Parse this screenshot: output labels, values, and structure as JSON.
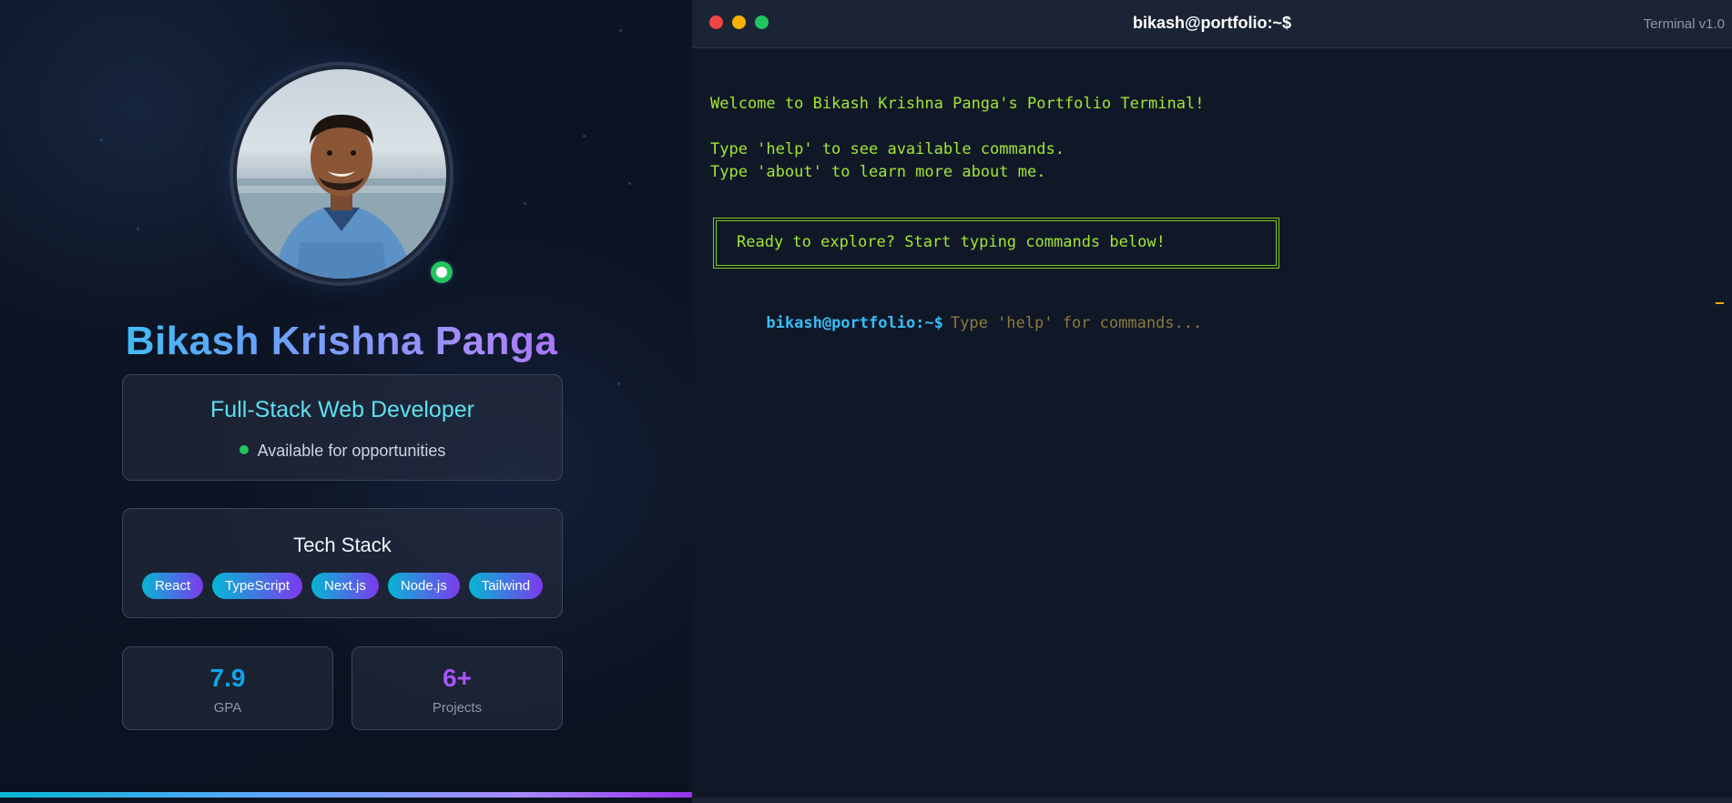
{
  "profile": {
    "name": "Bikash Krishna Panga",
    "role": "Full-Stack Web Developer",
    "availability": "Available for opportunities",
    "status": "online",
    "tech_stack": {
      "title": "Tech Stack",
      "items": [
        "React",
        "TypeScript",
        "Next.js",
        "Node.js",
        "Tailwind"
      ]
    },
    "stats": [
      {
        "value": "7.9",
        "label": "GPA",
        "color": "#0ea5e9"
      },
      {
        "value": "6+",
        "label": "Projects",
        "color": "#a855f7"
      }
    ]
  },
  "terminal": {
    "title": "bikash@portfolio:~$",
    "version": "Terminal v1.0",
    "lines": [
      "Welcome to Bikash Krishna Panga's Portfolio Terminal!",
      "Type 'help' to see available commands.",
      "Type 'about' to learn more about me."
    ],
    "banner": "Ready to explore? Start typing commands below!",
    "prompt": "bikash@portfolio:~$",
    "input_placeholder": "Type 'help' for commands..."
  },
  "colors": {
    "accent_cyan": "#22d3ee",
    "accent_purple": "#a855f7",
    "terminal_text": "#a3e635",
    "prompt": "#38bdf8",
    "online": "#22c55e"
  }
}
